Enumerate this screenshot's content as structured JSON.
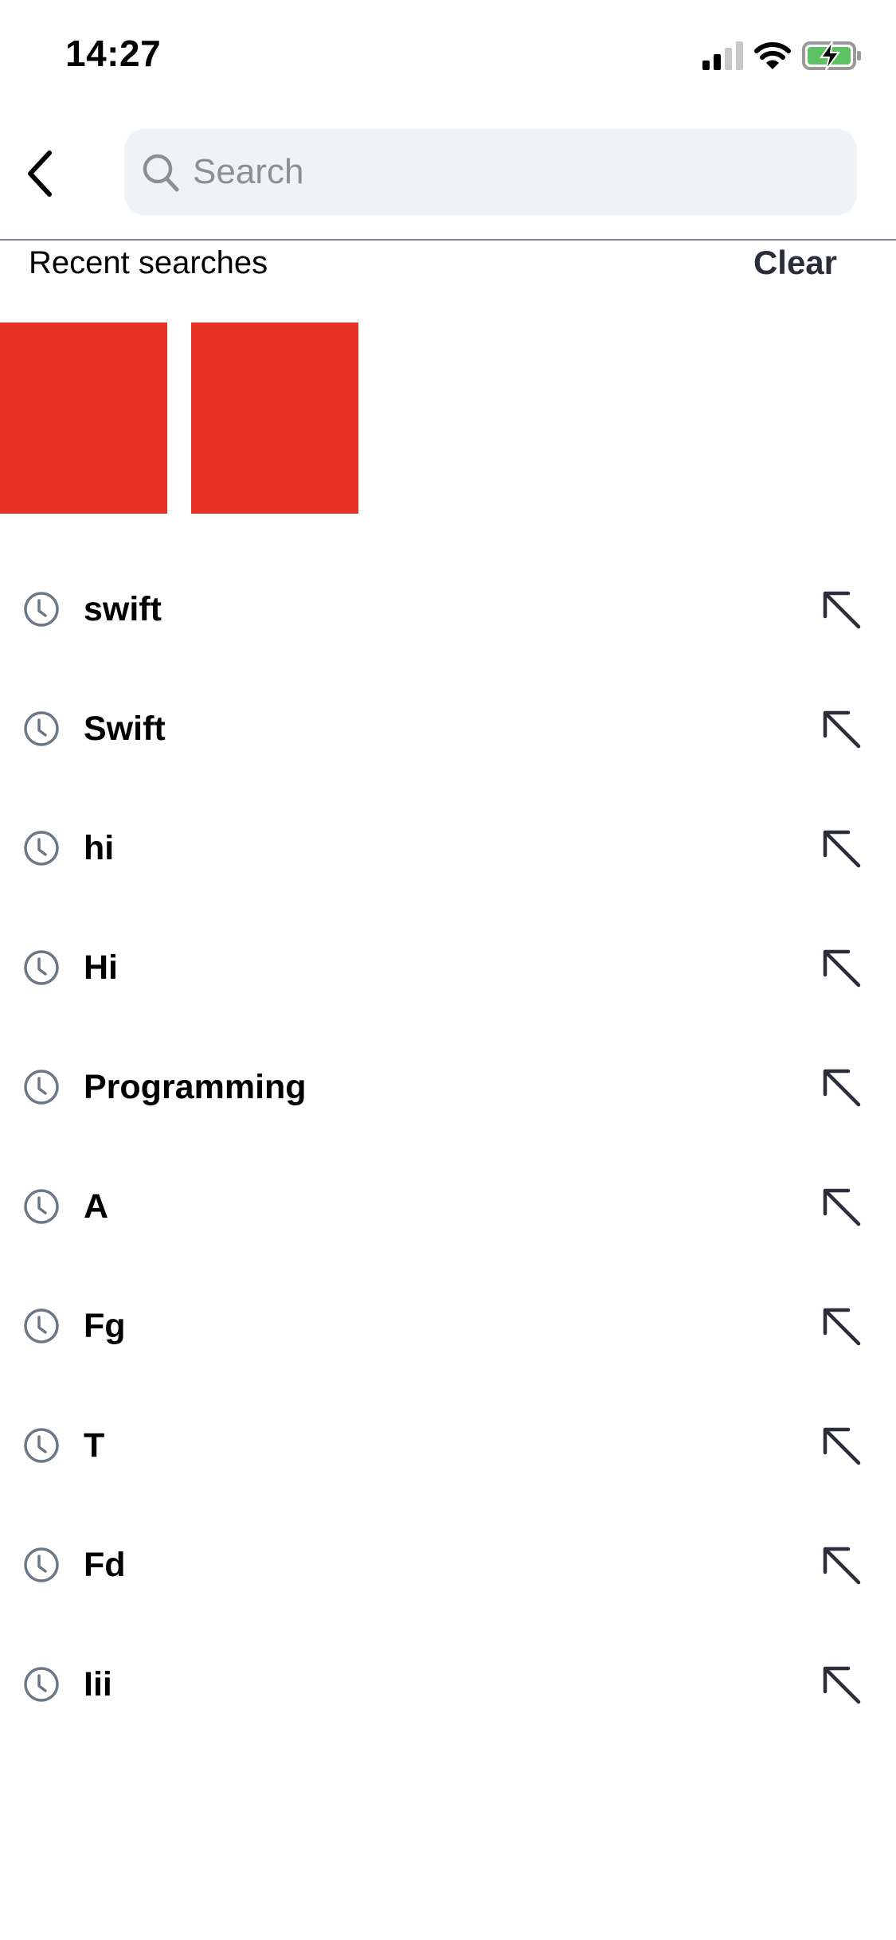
{
  "status_bar": {
    "time": "14:27",
    "signal_bars_active": 2,
    "signal_bars_total": 4,
    "wifi_icon": "wifi-icon",
    "battery_icon": "battery-charging-icon",
    "battery_color": "#5dc264"
  },
  "nav": {
    "back_icon": "chevron-left-icon",
    "search": {
      "icon": "search-icon",
      "placeholder": "Search",
      "value": ""
    }
  },
  "recent": {
    "title": "Recent searches",
    "clear_label": "Clear",
    "thumbnail_color": "#e83224",
    "thumbnails": [
      {
        "name": "recent-thumbnail-1"
      },
      {
        "name": "recent-thumbnail-2"
      }
    ],
    "items": [
      {
        "label": "swift",
        "icon": "clock-icon",
        "action_icon": "arrow-up-left-icon"
      },
      {
        "label": "Swift",
        "icon": "clock-icon",
        "action_icon": "arrow-up-left-icon"
      },
      {
        "label": "hi",
        "icon": "clock-icon",
        "action_icon": "arrow-up-left-icon"
      },
      {
        "label": "Hi",
        "icon": "clock-icon",
        "action_icon": "arrow-up-left-icon"
      },
      {
        "label": "Programming",
        "icon": "clock-icon",
        "action_icon": "arrow-up-left-icon"
      },
      {
        "label": "A",
        "icon": "clock-icon",
        "action_icon": "arrow-up-left-icon"
      },
      {
        "label": "Fg",
        "icon": "clock-icon",
        "action_icon": "arrow-up-left-icon"
      },
      {
        "label": "T",
        "icon": "clock-icon",
        "action_icon": "arrow-up-left-icon"
      },
      {
        "label": "Fd",
        "icon": "clock-icon",
        "action_icon": "arrow-up-left-icon"
      },
      {
        "label": "Iii",
        "icon": "clock-icon",
        "action_icon": "arrow-up-left-icon"
      }
    ]
  },
  "colors": {
    "search_bg": "#eff3f6",
    "icon_gray": "#6b7785",
    "arrow_dark": "#2b2d3a",
    "divider": "#7a8591"
  }
}
